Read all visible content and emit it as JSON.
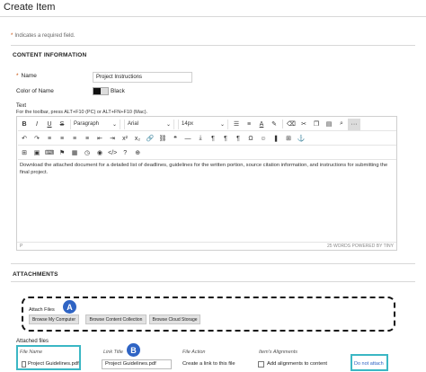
{
  "page": {
    "title": "Create Item"
  },
  "required_note": {
    "star": "*",
    "text": "Indicates a required field."
  },
  "content_info": {
    "heading": "CONTENT INFORMATION",
    "name_star": "*",
    "name_label": "Name",
    "name_value": "Project Instructions",
    "color_label": "Color of Name",
    "color_value": "Black",
    "text_label": "Text",
    "toolbar_hint": "For the toolbar, press ALT+F10 (PC) or ALT+FN+F10 (Mac)."
  },
  "editor": {
    "row1": {
      "bold": "B",
      "italic": "I",
      "underline": "U",
      "strike": "S",
      "paragraph": "Paragraph",
      "font": "Arial",
      "size": "14px",
      "list_bullet": "☰",
      "list_number": "≡",
      "font_color": "A",
      "highlight": "✎",
      "clear": "⌫",
      "cut": "✂",
      "copy": "❐",
      "paste": "▤",
      "find": "⌕",
      "more": "···"
    },
    "row2": {
      "undo": "↶",
      "redo": "↷",
      "align_left": "≡",
      "align_center": "≡",
      "align_right": "≡",
      "justify": "≡",
      "indent_out": "⇤",
      "indent_in": "⇥",
      "superscript": "x²",
      "subscript": "x₂",
      "link": "🔗",
      "unlink": "⛓",
      "blockquote": "❝",
      "hr": "―",
      "pagebreak": "⤓",
      "ltr": "¶",
      "rtl": "¶",
      "ltr2": "¶",
      "omega": "Ω",
      "emoji": "☺",
      "bookmark": "❚",
      "table": "⊞",
      "anchor": "⚓"
    },
    "row3": {
      "grid": "⊞",
      "image": "▣",
      "code": "⌨",
      "media": "⚑",
      "doc": "▦",
      "clock": "◷",
      "eye": "◉",
      "source": "</>",
      "help": "?",
      "add": "⊕"
    },
    "body": "Download the attached document for a detailed list of deadlines, guidelines for the written portion, source citation information, and instructions for submitting the final project.",
    "status_left": "P",
    "status_right": "25 WORDS  POWERED BY TINY"
  },
  "attachments": {
    "heading": "ATTACHMENTS",
    "attach_label": "Attach Files",
    "buttons": [
      "Browse My Computer",
      "Browse Content Collection",
      "Browse Cloud Storage"
    ],
    "badge_a": "A",
    "badge_b": "B",
    "attached_label": "Attached files",
    "columns": [
      "File Name",
      "Link Title",
      "File Action",
      "Item's Alignments"
    ],
    "row": {
      "file_name": "Project Guidelines.pdf",
      "link_title": "Project Guidelines.pdf",
      "file_action": "Create a link to this file",
      "alignment": "Add alignments to content",
      "action": "Do not attach"
    }
  },
  "colors": {
    "accent_blue": "#2f64c4",
    "highlight_teal": "#3bb7c4",
    "required_orange": "#c84a00"
  }
}
